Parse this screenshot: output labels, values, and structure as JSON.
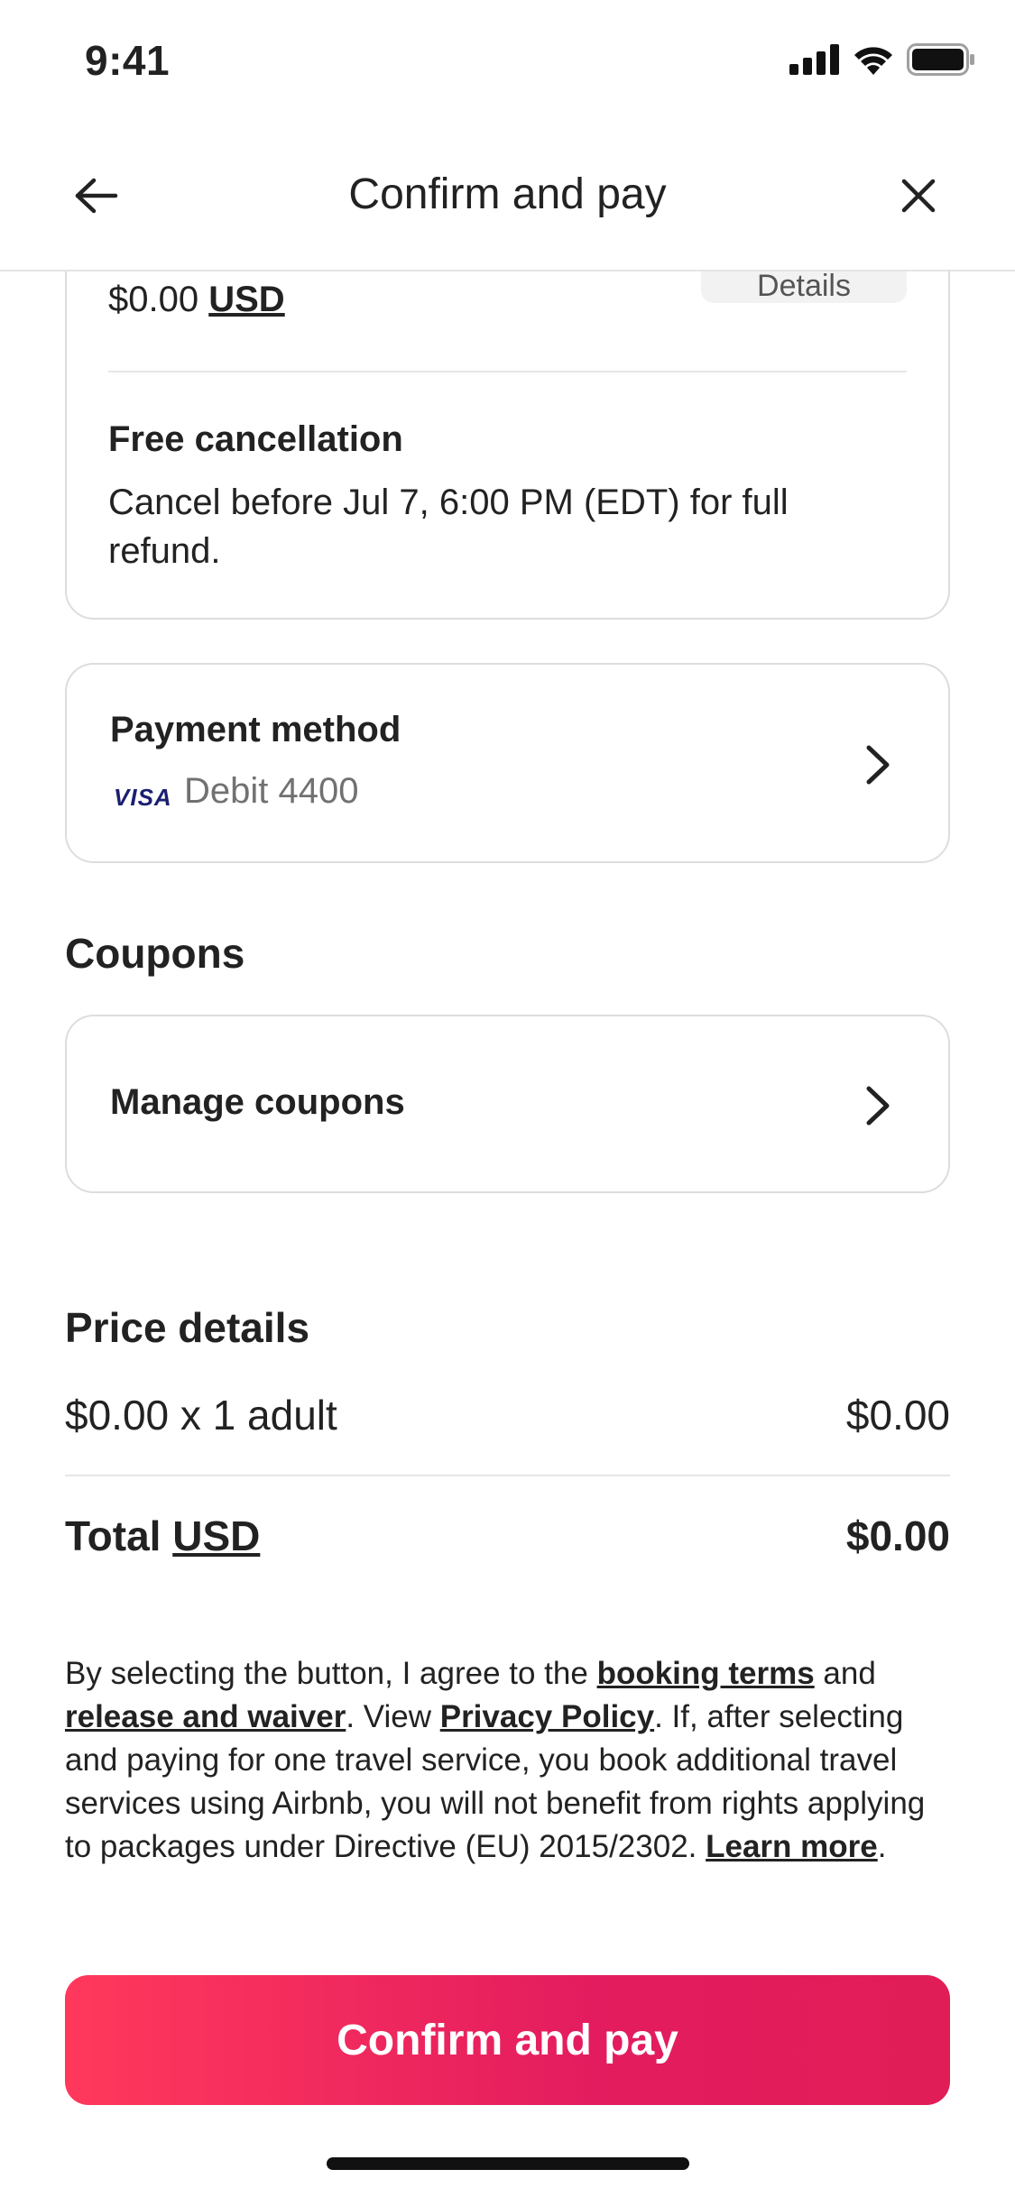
{
  "status_bar": {
    "time": "9:41"
  },
  "header": {
    "title": "Confirm and pay"
  },
  "summary_card": {
    "details_label": "Details",
    "price": "$0.00",
    "currency": "USD",
    "cancellation_title": "Free cancellation",
    "cancellation_text": "Cancel before Jul 7, 6:00 PM (EDT) for full refund."
  },
  "payment": {
    "title": "Payment method",
    "card_brand": "VISA",
    "card_label": "Debit 4400"
  },
  "coupons": {
    "heading": "Coupons",
    "manage_label": "Manage coupons"
  },
  "price_details": {
    "heading": "Price details",
    "line_label": "$0.00 x 1 adult",
    "line_value": "$0.00",
    "total_label": "Total",
    "total_currency": "USD",
    "total_value": "$0.00"
  },
  "legal": {
    "t1": "By selecting the button, I agree to the ",
    "booking_terms": "booking terms",
    "t2": " and ",
    "release_waiver": "release and waiver",
    "t3": ". View ",
    "privacy_policy": "Privacy Policy",
    "t4": ". If, after selecting and paying for one travel service, you book additional travel services using Airbnb, you will not benefit from rights applying to packages under Directive (EU) 2015/2302. ",
    "learn_more": "Learn more",
    "t5": "."
  },
  "confirm_button": {
    "label": "Confirm and pay"
  },
  "colors": {
    "accent": "#FF385C",
    "accent_end": "#E11D57",
    "text": "#222222",
    "muted": "#717171",
    "border": "#DDDDDD",
    "visa_blue": "#1A1F71"
  }
}
